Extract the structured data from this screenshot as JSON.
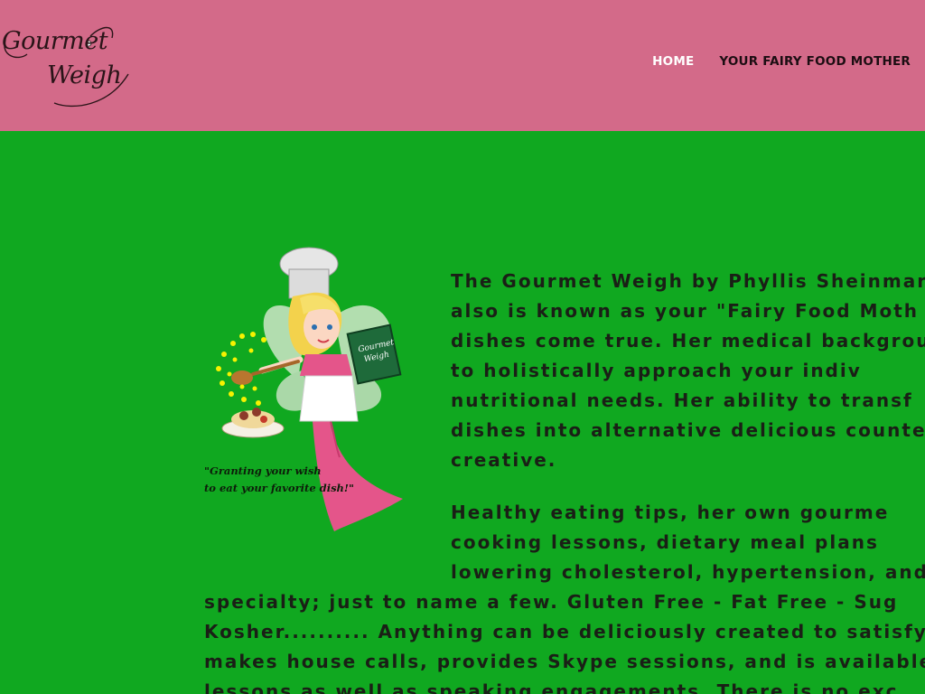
{
  "header": {
    "logo": {
      "line1": "Gourmet",
      "line2": "Weigh"
    },
    "nav": [
      {
        "label": "HOME"
      },
      {
        "label": "YOUR FAIRY FOOD MOTHER"
      }
    ]
  },
  "hero": {
    "caption": [
      "\"Granting your wish",
      "to eat your favorite dish!\""
    ],
    "book_label": [
      "Gourmet",
      "Weigh"
    ]
  },
  "intro": {
    "lines": [
      "The Gourmet Weigh by Phyllis Sheinman",
      "also is known as your  \"Fairy Food Moth",
      "dishes come true. Her medical backgroun",
      "to  holistically  approach  your  indiv",
      "nutritional needs. Her ability to transf",
      "dishes into alternative delicious counter",
      "creative."
    ]
  },
  "services": {
    "lines": [
      "Healthy  eating  tips,  her  own  gourme",
      "cooking  lessons,  dietary  meal  plans",
      "lowering  cholesterol,  hypertension,  and",
      "specialty; just to name a few. Gluten Free - Fat Free - Sug",
      "Kosher.......... Anything can be deliciously created to satisfy",
      "makes house calls, provides  Skype sessions, and is available",
      "lessons as well as speaking engagements. There is no exc"
    ]
  }
}
